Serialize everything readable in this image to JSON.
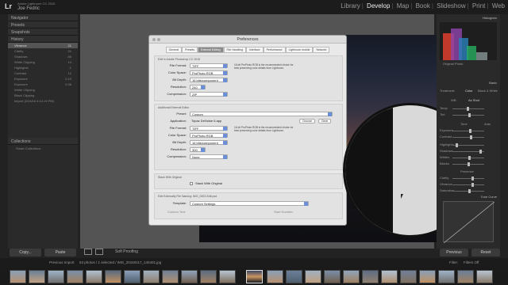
{
  "app": {
    "logo": "Lr",
    "subtitle": "Adobe Lightroom CC 2015",
    "user": "Joe Fedric"
  },
  "modules": [
    "Library",
    "Develop",
    "Map",
    "Book",
    "Slideshow",
    "Print",
    "Web"
  ],
  "active_module": "Develop",
  "left_panel": {
    "navigator": "Navigator",
    "presets": "Presets",
    "snapshots": "Snapshots",
    "history": "History",
    "collections": "Collections",
    "history_items": [
      {
        "label": "Vibrance",
        "a": "+21",
        "b": "21"
      },
      {
        "label": "Clarity",
        "a": "+",
        "b": "21"
      },
      {
        "label": "Shadows",
        "a": "+",
        "b": "85"
      },
      {
        "label": "White Clipping",
        "a": "",
        "b": "14"
      },
      {
        "label": "Highlights",
        "a": "",
        "b": "-1"
      },
      {
        "label": "Contrast",
        "a": "",
        "b": "12"
      },
      {
        "label": "Exposure",
        "a": "",
        "b": "0.10"
      },
      {
        "label": "Exposure",
        "a": "",
        "b": "0.36"
      },
      {
        "label": "White Clipping",
        "a": "",
        "b": ""
      },
      {
        "label": "Black Clipping",
        "a": "",
        "b": ""
      },
      {
        "label": "Import (2/24/16 4:14:19 PM)",
        "a": "",
        "b": ""
      }
    ],
    "smart_collections": "Smart Collections",
    "copy_btn": "Copy...",
    "paste_btn": "Paste"
  },
  "dialog": {
    "title": "Preferences",
    "tabs": [
      "General",
      "Presets",
      "External Editing",
      "File Handling",
      "Interface",
      "Performance",
      "Lightroom mobile",
      "Network"
    ],
    "active_tab": "External Editing",
    "group1_title": "Edit in Adobe Photoshop CC 2015",
    "group2_title": "Additional External Editor",
    "group3_title": "Stack With Original",
    "group4_title": "Edit Externally File Naming: IMG_0002-Edit.psd",
    "file_format_label": "File Format:",
    "file_format": "TIFF",
    "color_space_label": "Color Space:",
    "color_space": "ProPhoto RGB",
    "bit_depth_label": "Bit Depth:",
    "bit_depth": "16 bits/component",
    "resolution_label": "Resolution:",
    "resolution1": "240",
    "compression_label": "Compression:",
    "compression": "ZIP",
    "note1": "16-bit ProPhoto RGB is the recommended choice for best preserving color details from Lightroom.",
    "preset_label": "Preset:",
    "preset": "Custom",
    "application_label": "Application:",
    "application": "Topaz DeNoise 6.app",
    "choose_btn": "Choose",
    "clear_btn": "Clear",
    "resolution2": "300",
    "compression2": "None",
    "stack_label": "Stack With Original",
    "template_label": "Template:",
    "template": "Custom Settings",
    "custom_text_label": "Custom Text:",
    "start_number_label": "Start Number:"
  },
  "right_panel": {
    "histogram": "Histogram",
    "original_photo": "Original Photo",
    "basic": "Basic",
    "treatment": "Treatment:",
    "color": "Color",
    "bw": "Black & White",
    "wb": "WB:",
    "as_shot": "As Shot",
    "temp": "Temp",
    "tint": "Tint",
    "tone": "Tone",
    "auto": "Auto",
    "exposure": "Exposure",
    "contrast": "Contrast",
    "highlights": "Highlights",
    "shadows": "Shadows",
    "whites": "Whites",
    "blacks": "Blacks",
    "presence": "Presence",
    "clarity": "Clarity",
    "vibrance": "Vibrance",
    "saturation": "Saturation",
    "tone_curve": "Tone Curve",
    "previous_btn": "Previous",
    "reset_btn": "Reset"
  },
  "toolbar": {
    "soft_proofing": "Soft Proofing"
  },
  "filmstrip": {
    "previous_import": "Previous Import",
    "count_text": "63 photos / 1 selected / IMG_20160117_140401.jpg",
    "filter_label": "Filter:",
    "filter_value": "Filters Off"
  }
}
